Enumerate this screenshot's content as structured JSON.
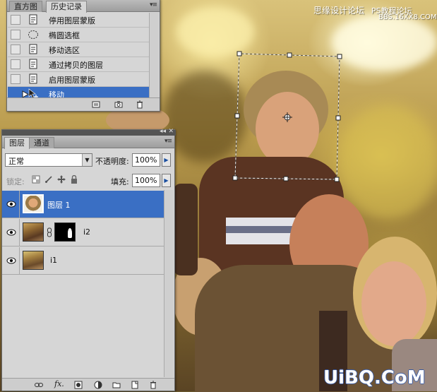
{
  "history_panel": {
    "tabs": [
      "直方图",
      "历史记录"
    ],
    "active_tab": 1,
    "items": [
      {
        "label": "停用图层蒙版",
        "icon": "history-step-icon"
      },
      {
        "label": "椭圆选框",
        "icon": "ellipse-marquee-icon"
      },
      {
        "label": "移动选区",
        "icon": "history-step-icon"
      },
      {
        "label": "通过拷贝的图层",
        "icon": "history-step-icon"
      },
      {
        "label": "启用图层蒙版",
        "icon": "history-step-icon"
      },
      {
        "label": "移动",
        "icon": "move-tool-icon",
        "selected": true
      }
    ]
  },
  "layers_panel": {
    "tabs": [
      "图层",
      "通道"
    ],
    "active_tab": 0,
    "blend_mode": "正常",
    "opacity_label": "不透明度:",
    "opacity_value": "100%",
    "lock_label": "锁定:",
    "fill_label": "填充:",
    "fill_value": "100%",
    "layers": [
      {
        "name": "图层 1",
        "selected": true,
        "visible": true
      },
      {
        "name": "i2",
        "selected": false,
        "visible": true,
        "has_mask": true
      },
      {
        "name": "i1",
        "selected": false,
        "visible": true
      }
    ]
  },
  "watermarks": {
    "top": "思缘设计论坛",
    "url_text": "PS教程论坛",
    "url": "BBS.16XX8.COM",
    "bottom": "UiBQ.CoM"
  },
  "colors": {
    "selection": "#3a6fc4",
    "panel_bg": "#d6d6d6"
  }
}
